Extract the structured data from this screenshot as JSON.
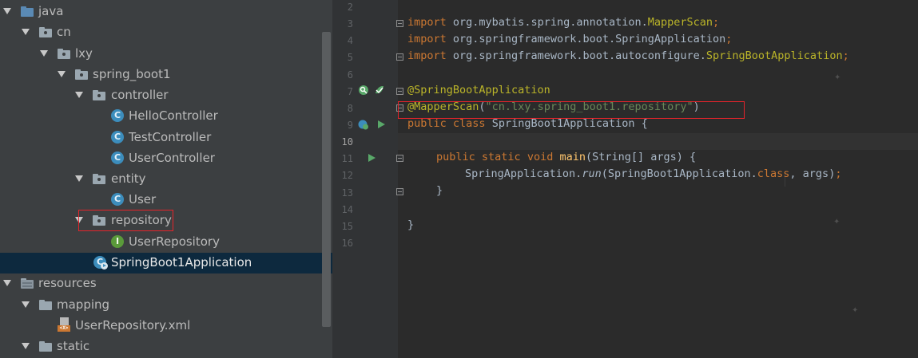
{
  "tree": {
    "items": [
      {
        "label": "java",
        "kind": "folder-blue"
      },
      {
        "label": "cn",
        "kind": "package"
      },
      {
        "label": "lxy",
        "kind": "package"
      },
      {
        "label": "spring_boot1",
        "kind": "package"
      },
      {
        "label": "controller",
        "kind": "package"
      },
      {
        "label": "HelloController",
        "kind": "class"
      },
      {
        "label": "TestController",
        "kind": "class"
      },
      {
        "label": "UserController",
        "kind": "class"
      },
      {
        "label": "entity",
        "kind": "package"
      },
      {
        "label": "User",
        "kind": "class"
      },
      {
        "label": "repository",
        "kind": "package"
      },
      {
        "label": "UserRepository",
        "kind": "interface"
      },
      {
        "label": "SpringBoot1Application",
        "kind": "app-class"
      },
      {
        "label": "resources",
        "kind": "folder-resources"
      },
      {
        "label": "mapping",
        "kind": "folder"
      },
      {
        "label": "UserRepository.xml",
        "kind": "xml-file"
      },
      {
        "label": "static",
        "kind": "folder"
      }
    ],
    "class_badge": "C",
    "interface_badge": "I",
    "xml_badge": "<X>"
  },
  "editor": {
    "line_numbers": [
      "2",
      "3",
      "4",
      "5",
      "6",
      "7",
      "8",
      "9",
      "10",
      "11",
      "12",
      "13",
      "14",
      "15",
      "16"
    ],
    "lines": {
      "l3": {
        "kw": "import",
        "rest": " org.mybatis.spring.annotation.",
        "cls": "MapperScan",
        "end": ";"
      },
      "l4": {
        "kw": "import",
        "rest": " org.springframework.boot.SpringApplication",
        "end": ";"
      },
      "l5": {
        "kw": "import",
        "rest": " org.springframework.boot.autoconfigure.",
        "cls": "SpringBootApplication",
        "end": ";"
      },
      "l7": {
        "ann": "@SpringBootApplication"
      },
      "l8": {
        "ann": "@MapperScan",
        "open": "(",
        "str": "\"cn.lxy.spring_boot1.repository\"",
        "close": ")"
      },
      "l9": {
        "kw1": "public",
        "kw2": "class",
        "rest": " SpringBoot1Application {"
      },
      "l11": {
        "kw1": "public",
        "kw2": "static",
        "kw3": "void",
        "fn": "main",
        "rest": "(String[] args) {"
      },
      "l12": {
        "a": "SpringApplication.",
        "fn": "run",
        "b": "(SpringBoot1Application.",
        "kw": "class",
        "c": ", args)",
        "end": ";"
      },
      "l13": {
        "brace": "}"
      },
      "l15": {
        "brace": "}"
      }
    }
  },
  "colors": {
    "keyword": "#cc7832",
    "annotation": "#bbb529",
    "string": "#6a8759",
    "default": "#a9b7c6",
    "highlight_box": "#e5242b"
  }
}
